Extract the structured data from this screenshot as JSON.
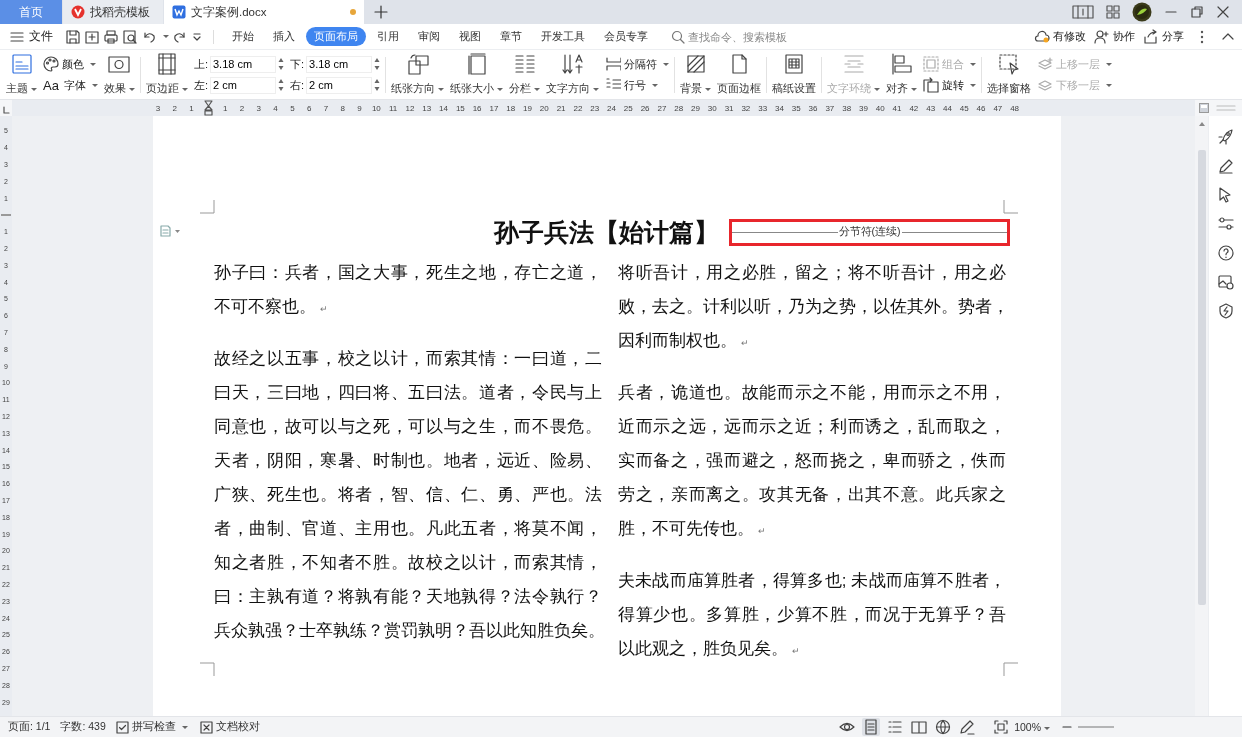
{
  "titlebar": {
    "tabs": [
      {
        "label": "首页",
        "kind": "home",
        "selected": false,
        "modified": false
      },
      {
        "label": "找稻壳模板",
        "kind": "template",
        "selected": false,
        "modified": false
      },
      {
        "label": "文字案例.docx",
        "kind": "document",
        "selected": true,
        "modified": true
      }
    ]
  },
  "menu": {
    "file": "文件",
    "tabs": [
      {
        "label": "开始",
        "selected": false
      },
      {
        "label": "插入",
        "selected": false
      },
      {
        "label": "页面布局",
        "selected": true
      },
      {
        "label": "引用",
        "selected": false
      },
      {
        "label": "审阅",
        "selected": false
      },
      {
        "label": "视图",
        "selected": false
      },
      {
        "label": "章节",
        "selected": false
      },
      {
        "label": "开发工具",
        "selected": false
      },
      {
        "label": "会员专享",
        "selected": false
      }
    ],
    "search": {
      "placeholder": "查找命令、搜索模板"
    },
    "actions": [
      {
        "label": "有修改"
      },
      {
        "label": "协作"
      },
      {
        "label": "分享"
      }
    ]
  },
  "ribbon": [
    {
      "items": [
        {
          "kind": "big",
          "label": "主题",
          "dropdown": true,
          "disabled": false
        },
        {
          "kind": "pair",
          "items": [
            {
              "label": "颜色",
              "dropdown": true,
              "disabled": false
            },
            {
              "label": "字体",
              "glyph": "Aa",
              "dropdown": true,
              "disabled": false
            }
          ]
        },
        {
          "kind": "big",
          "label": "效果",
          "dropdown": true,
          "disabled": false
        }
      ]
    },
    {
      "items": [
        {
          "kind": "big",
          "label": "页边距",
          "dropdown": true,
          "disabled": false
        },
        {
          "kind": "fields",
          "items": [
            {
              "label": "上:",
              "value": "3.18 cm"
            },
            {
              "label": "左:",
              "value": "2 cm"
            }
          ]
        },
        {
          "kind": "fields",
          "items": [
            {
              "label": "下:",
              "value": "3.18 cm"
            },
            {
              "label": "右:",
              "value": "2 cm"
            }
          ]
        }
      ]
    },
    {
      "items": [
        {
          "kind": "big",
          "label": "纸张方向",
          "dropdown": true,
          "disabled": false
        },
        {
          "kind": "big",
          "label": "纸张大小",
          "dropdown": true,
          "disabled": false
        },
        {
          "kind": "big",
          "label": "分栏",
          "dropdown": true,
          "disabled": false
        },
        {
          "kind": "big",
          "label": "文字方向",
          "dropdown": true,
          "disabled": false
        },
        {
          "kind": "pair",
          "items": [
            {
              "label": "分隔符",
              "dropdown": true,
              "disabled": false
            },
            {
              "label": "行号",
              "dropdown": true,
              "disabled": false
            }
          ]
        }
      ]
    },
    {
      "items": [
        {
          "kind": "big",
          "label": "背景",
          "dropdown": true,
          "disabled": false
        },
        {
          "kind": "big",
          "label": "页面边框",
          "dropdown": false,
          "disabled": false
        }
      ]
    },
    {
      "items": [
        {
          "kind": "big",
          "label": "稿纸设置",
          "dropdown": false,
          "disabled": false
        }
      ]
    },
    {
      "items": [
        {
          "kind": "big",
          "label": "文字环绕",
          "dropdown": true,
          "disabled": true
        },
        {
          "kind": "big",
          "label": "对齐",
          "dropdown": true,
          "disabled": false
        },
        {
          "kind": "pair",
          "items": [
            {
              "label": "组合",
              "dropdown": true,
              "disabled": true
            },
            {
              "label": "旋转",
              "dropdown": true,
              "disabled": false
            }
          ]
        }
      ]
    },
    {
      "items": [
        {
          "kind": "big",
          "label": "选择窗格",
          "dropdown": false,
          "disabled": false
        },
        {
          "kind": "pair",
          "items": [
            {
              "label": "上移一层",
              "dropdown": true,
              "disabled": true
            },
            {
              "label": "下移一层",
              "dropdown": true,
              "disabled": true
            }
          ]
        }
      ]
    }
  ],
  "ruler": {
    "before": [
      "3",
      "2",
      "1"
    ],
    "after": [
      "1",
      "2",
      "3",
      "4",
      "5",
      "6",
      "7",
      "8",
      "9",
      "10",
      "11",
      "12",
      "13",
      "14",
      "15",
      "16",
      "17",
      "18",
      "19",
      "20",
      "21",
      "22",
      "23",
      "24",
      "25",
      "26",
      "27",
      "28",
      "29",
      "30",
      "31",
      "32",
      "33",
      "34",
      "35",
      "36",
      "37",
      "38",
      "39",
      "40",
      "41",
      "42",
      "43",
      "44",
      "45",
      "46",
      "47",
      "48"
    ]
  },
  "vertical_ruler": {
    "before": [
      "5",
      "4",
      "3",
      "2",
      "1"
    ],
    "after": [
      "1",
      "2",
      "3",
      "4",
      "5",
      "6",
      "7",
      "8",
      "9",
      "10",
      "11",
      "12",
      "13",
      "14",
      "15",
      "16",
      "17",
      "18",
      "19",
      "20",
      "21",
      "22",
      "23",
      "24",
      "25",
      "26",
      "27",
      "28",
      "29"
    ]
  },
  "document": {
    "title": "孙子兵法【始计篇】",
    "section_break": "分节符(连续)",
    "columns": [
      {
        "paragraphs": [
          {
            "lines": [
              "孙子曰：兵者，国之大事，死生之地，存亡之道，",
              "不可不察也。"
            ],
            "end_mark": "↵"
          },
          {
            "lines": [
              "故经之以五事，校之以计，而索其情：一曰道，二",
              "曰天，三曰地，四曰将、五曰法。道者，令民与上",
              "同意也，故可以与之死，可以与之生，而不畏危。",
              "天者，阴阳，寒暑、时制也。地者，远近、险易、",
              "广狭、死生也。将者，智、信、仁、勇、严也。法",
              "者，曲制、官道、主用也。凡此五者，将莫不闻，",
              "知之者胜，不知者不胜。故校之以计，而索其情，",
              "曰：主孰有道？将孰有能？天地孰得？法令孰行？",
              "兵众孰强？士卒孰练？赏罚孰明？吾以此知胜负矣。"
            ]
          }
        ]
      },
      {
        "paragraphs": [
          {
            "lines": [
              "将听吾计，用之必胜，留之；将不听吾计，用之必",
              "败，去之。计利以听，乃为之势，以佐其外。势者，",
              "因利而制权也。"
            ],
            "end_mark": "↵"
          },
          {
            "lines": [
              "兵者，诡道也。故能而示之不能，用而示之不用，",
              "近而示之远，远而示之近；利而诱之，乱而取之，",
              "实而备之，强而避之，怒而挠之，卑而骄之，佚而",
              "劳之，亲而离之。攻其无备，出其不意。此兵家之",
              "胜，不可先传也。"
            ],
            "end_mark": "↵"
          },
          {
            "lines": [
              "夫未战而庙算胜者，得算多也; 未战而庙算不胜者，",
              "得算少也。多算胜，少算不胜，而况于无算乎？吾",
              "以此观之，胜负见矣。"
            ],
            "end_mark": "↵"
          }
        ]
      }
    ]
  },
  "status_bar": {
    "items": [
      {
        "kind": "text",
        "label": "页面: 1/1",
        "dropdown": false
      },
      {
        "kind": "text",
        "label": "字数: 439",
        "dropdown": false
      },
      {
        "kind": "spellcheck",
        "label": "拼写检查",
        "dropdown": true
      },
      {
        "kind": "proofread",
        "label": "文档校对",
        "dropdown": false
      }
    ],
    "views": [
      {
        "selected": false
      },
      {
        "selected": true
      },
      {
        "selected": false
      },
      {
        "selected": false
      },
      {
        "selected": false
      },
      {
        "selected": false
      }
    ],
    "zoom": "100%"
  }
}
